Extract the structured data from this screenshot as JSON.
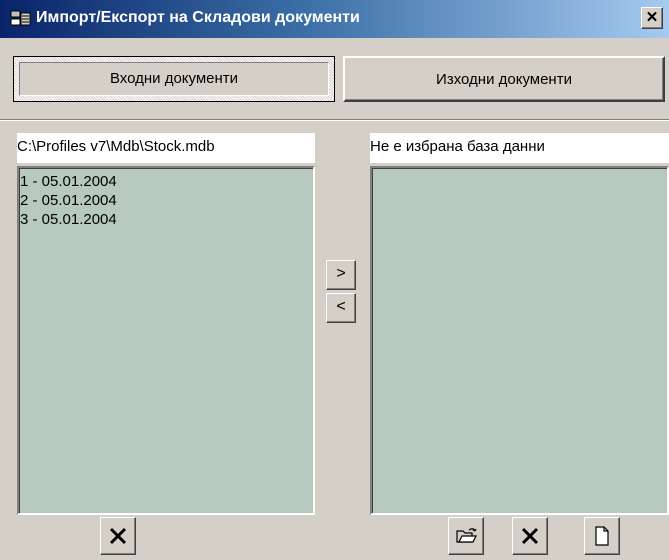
{
  "window": {
    "title": "Импорт/Експорт на Складови документи",
    "close_symbol": "✕",
    "icon": "database-icon"
  },
  "tabs": [
    {
      "label": "Входни документи",
      "active": true
    },
    {
      "label": "Изходни документи",
      "active": false
    }
  ],
  "left_panel": {
    "path": "C:\\Profiles v7\\Mdb\\Stock.mdb",
    "items": [
      "1 - 05.01.2004",
      "2 - 05.01.2004",
      "3 - 05.01.2004"
    ]
  },
  "right_panel": {
    "path": "Не е избрана база данни",
    "items": []
  },
  "transfer": {
    "right_label": ">",
    "left_label": "<"
  },
  "toolbar": {
    "left_delete_icon": "delete-x-icon",
    "open_icon": "open-folder-icon",
    "right_delete_icon": "delete-x-icon",
    "new_icon": "new-document-icon"
  },
  "colors": {
    "title_start": "#0a246a",
    "title_end": "#a6caf0",
    "list_bg": "#b7c9bf",
    "face": "#d4d0c8"
  }
}
